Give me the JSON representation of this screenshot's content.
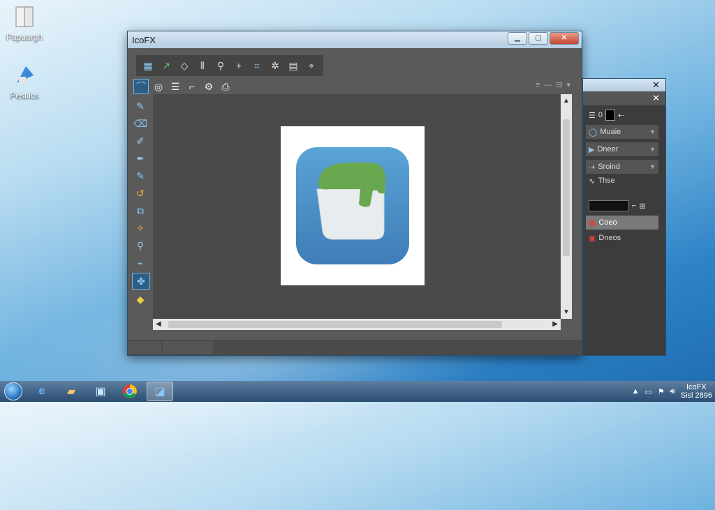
{
  "desktop": {
    "icons": [
      {
        "label": "Papuargh"
      },
      {
        "label": "Pestiics"
      }
    ]
  },
  "window": {
    "title": "IcoFX",
    "controls": {
      "minimize": "▁",
      "maximize": "▢",
      "close": "✕"
    }
  },
  "side_panel": {
    "close1": "✕",
    "close2": "✕",
    "header_text": "0",
    "rows": [
      {
        "icon": "◯",
        "label": "Muaie"
      },
      {
        "icon": "▶",
        "label": "Dneer"
      },
      {
        "icon": "⇢",
        "label": "Sroind"
      },
      {
        "icon": "∿",
        "label": "Thse"
      },
      {
        "icon": "▣",
        "label": "Coeo"
      },
      {
        "icon": "▣",
        "label": "Dneos"
      }
    ]
  },
  "taskbar": {
    "clock_line1": "IcoFX",
    "clock_line2": "Sisl 2896"
  },
  "colors": {
    "accent": "#2d5f86",
    "icon_blue": "#4b8fca",
    "icon_green": "#6aa84f"
  }
}
